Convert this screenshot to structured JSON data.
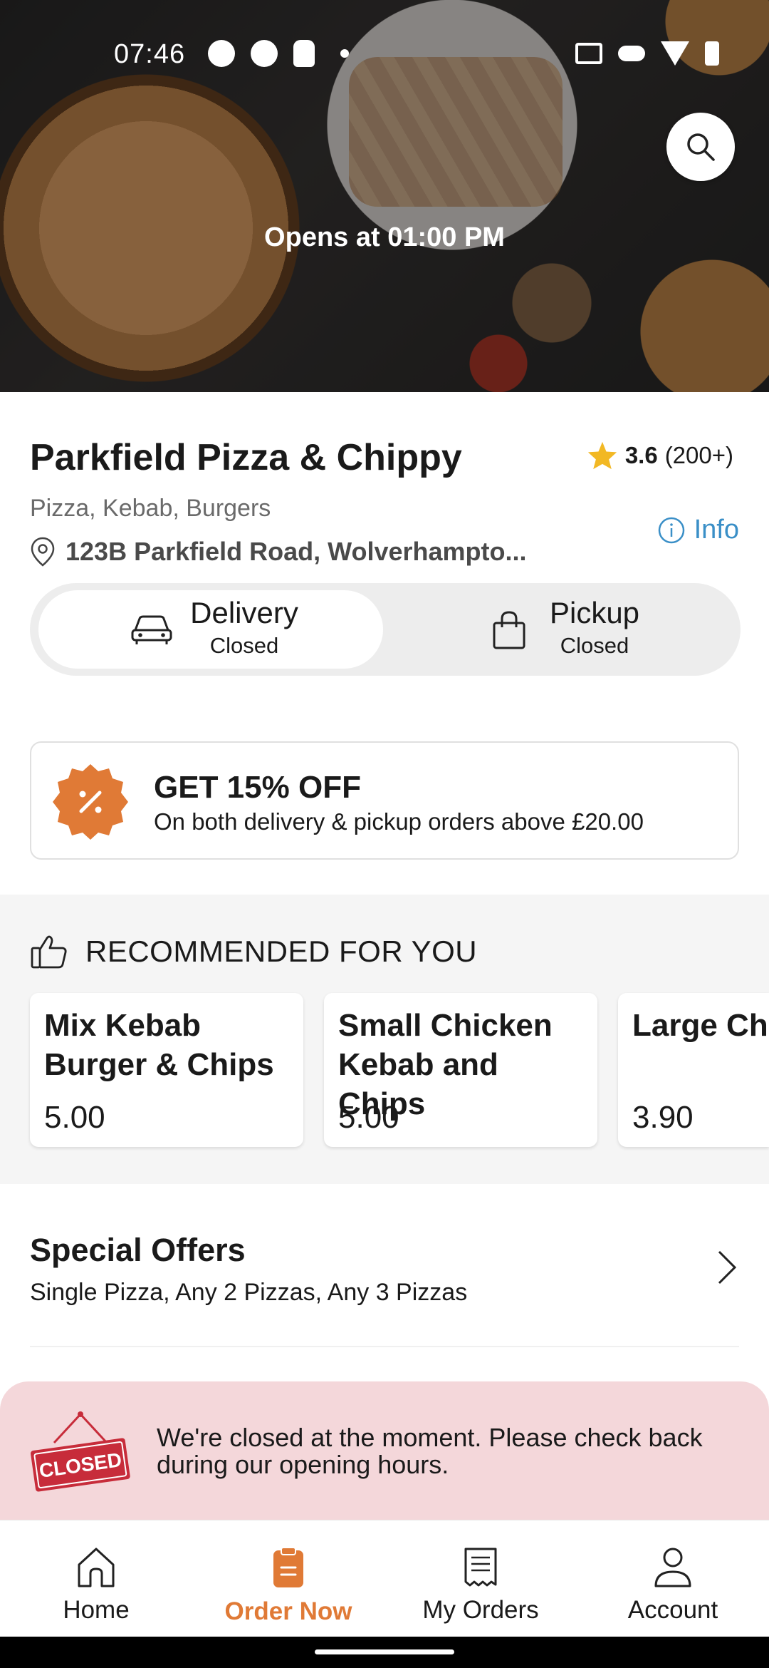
{
  "status_bar": {
    "time": "07:46"
  },
  "hero": {
    "opens_text": "Opens at 01:00 PM"
  },
  "store": {
    "name": "Parkfield Pizza & Chippy",
    "rating_value": "3.6",
    "rating_count": "(200+)",
    "cuisines": "Pizza, Kebab, Burgers",
    "address": "123B Parkfield Road, Wolverhampto...",
    "info_label": "Info"
  },
  "modes": {
    "delivery": {
      "title": "Delivery",
      "status": "Closed"
    },
    "pickup": {
      "title": "Pickup",
      "status": "Closed"
    }
  },
  "promo": {
    "title": "GET 15% OFF",
    "subtitle": "On both delivery & pickup orders above £20.00"
  },
  "recommended": {
    "title": "RECOMMENDED FOR YOU",
    "items": [
      {
        "name": "Mix Kebab Burger & Chips",
        "price": "5.00"
      },
      {
        "name": "Small Chicken Kebab and Chips",
        "price": "5.00"
      },
      {
        "name": "Large Chi",
        "price": "3.90"
      }
    ]
  },
  "special_offers": {
    "title": "Special Offers",
    "subtitle": "Single Pizza, Any 2 Pizzas, Any 3 Pizzas"
  },
  "closed_banner": {
    "sign_text": "CLOSED",
    "message": "We're closed at the moment. Please check back during our opening hours."
  },
  "bottom_nav": {
    "items": [
      {
        "label": "Home",
        "icon": "home-icon"
      },
      {
        "label": "Order Now",
        "icon": "order-icon",
        "active": true
      },
      {
        "label": "My Orders",
        "icon": "receipt-icon"
      },
      {
        "label": "Account",
        "icon": "account-icon"
      }
    ]
  },
  "colors": {
    "accent": "#e07a36",
    "info": "#3a8fc7",
    "closed_banner_bg": "#f4d7da",
    "star": "#f2b824"
  }
}
